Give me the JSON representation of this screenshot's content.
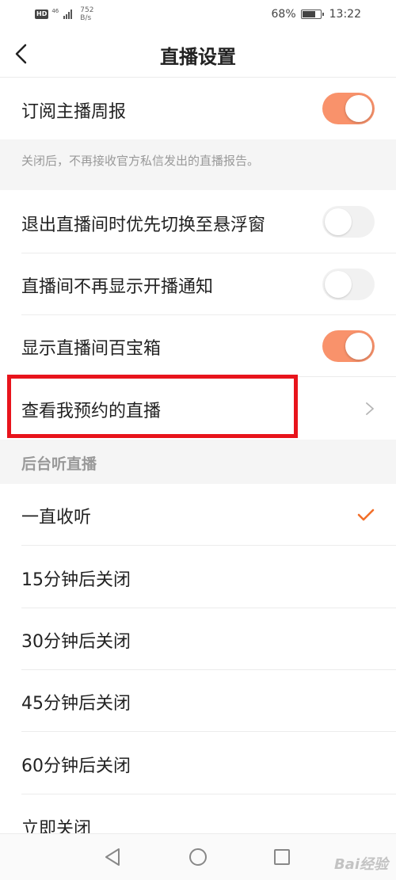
{
  "status_bar": {
    "network_badge": "HD",
    "network_type": "46",
    "speed_value": "752",
    "speed_unit": "B/s",
    "battery": "68%",
    "battery_level": 0.68,
    "time": "13:22"
  },
  "header": {
    "title": "直播设置",
    "back_icon": "chevron-left-icon"
  },
  "settings": {
    "subscribe_weekly": {
      "label": "订阅主播周报",
      "enabled": true
    },
    "subscribe_note": "关闭后，不再接收官方私信发出的直播报告。",
    "float_window": {
      "label": "退出直播间时优先切换至悬浮窗",
      "enabled": false
    },
    "no_start_notice": {
      "label": "直播间不再显示开播通知",
      "enabled": false
    },
    "treasure_box": {
      "label": "显示直播间百宝箱",
      "enabled": true
    },
    "my_reservations": {
      "label": "查看我预约的直播"
    }
  },
  "background_listen": {
    "section_title": "后台听直播",
    "options": [
      {
        "label": "一直收听",
        "selected": true
      },
      {
        "label": "15分钟后关闭",
        "selected": false
      },
      {
        "label": "30分钟后关闭",
        "selected": false
      },
      {
        "label": "45分钟后关闭",
        "selected": false
      },
      {
        "label": "60分钟后关闭",
        "selected": false
      },
      {
        "label": "立即关闭",
        "selected": false
      }
    ]
  },
  "colors": {
    "toggle_on": "#f9926b",
    "toggle_off": "#f1f1f1",
    "check": "#f26f2a",
    "highlight_box": "#e8141c"
  },
  "watermark": "Bai经验"
}
